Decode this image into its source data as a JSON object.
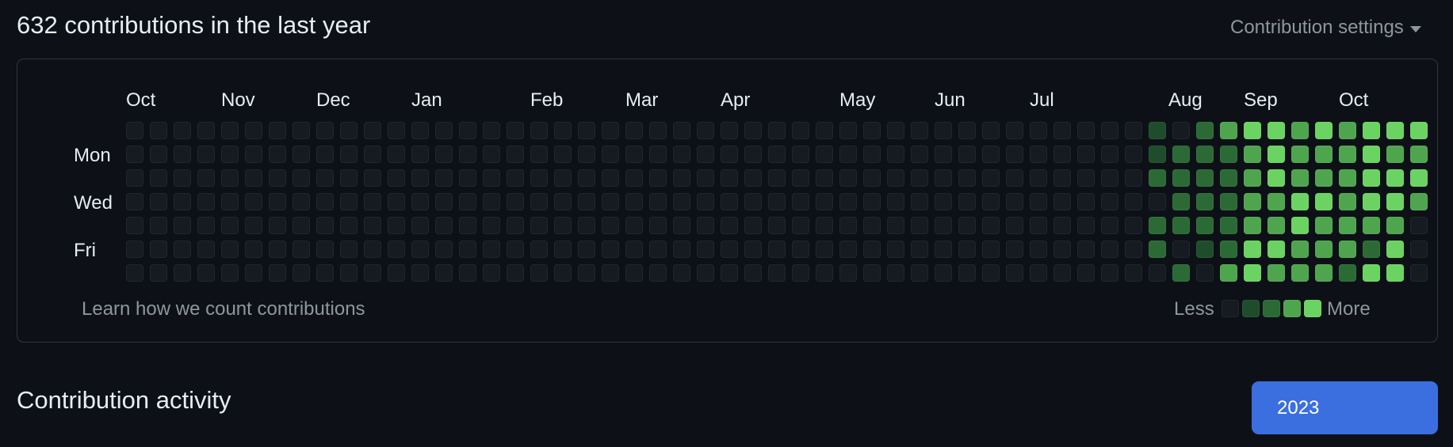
{
  "header": {
    "title": "632 contributions in the last year",
    "settings_label": "Contribution settings"
  },
  "calendar": {
    "months": [
      "Oct",
      "Nov",
      "Dec",
      "Jan",
      "Feb",
      "Mar",
      "Apr",
      "May",
      "Jun",
      "Jul",
      "Aug",
      "Sep",
      "Oct"
    ],
    "days": [
      "Mon",
      "Wed",
      "Fri"
    ],
    "levels": [
      "0000000000000000000000000000000000000000000102344343444",
      "0000000000000000000000000000000000000000000122234333433",
      "0000000000000000000000000000000000000000000222234333444",
      "0000000000000000000000000000000000000000000022233443443",
      "0000000000000000000000000000000000000000000222233433330",
      "0000000000000000000000000000000000000000000201244333240",
      "0000000000000000000000000000000000000000000020343332440"
    ],
    "colors": [
      "#161b22",
      "#1e4d2b",
      "#2b6a35",
      "#4ea54e",
      "#6bd361"
    ]
  },
  "footer": {
    "learn_link": "Learn how we count contributions",
    "less_label": "Less",
    "more_label": "More"
  },
  "activity": {
    "title": "Contribution activity",
    "year_button": "2023"
  }
}
